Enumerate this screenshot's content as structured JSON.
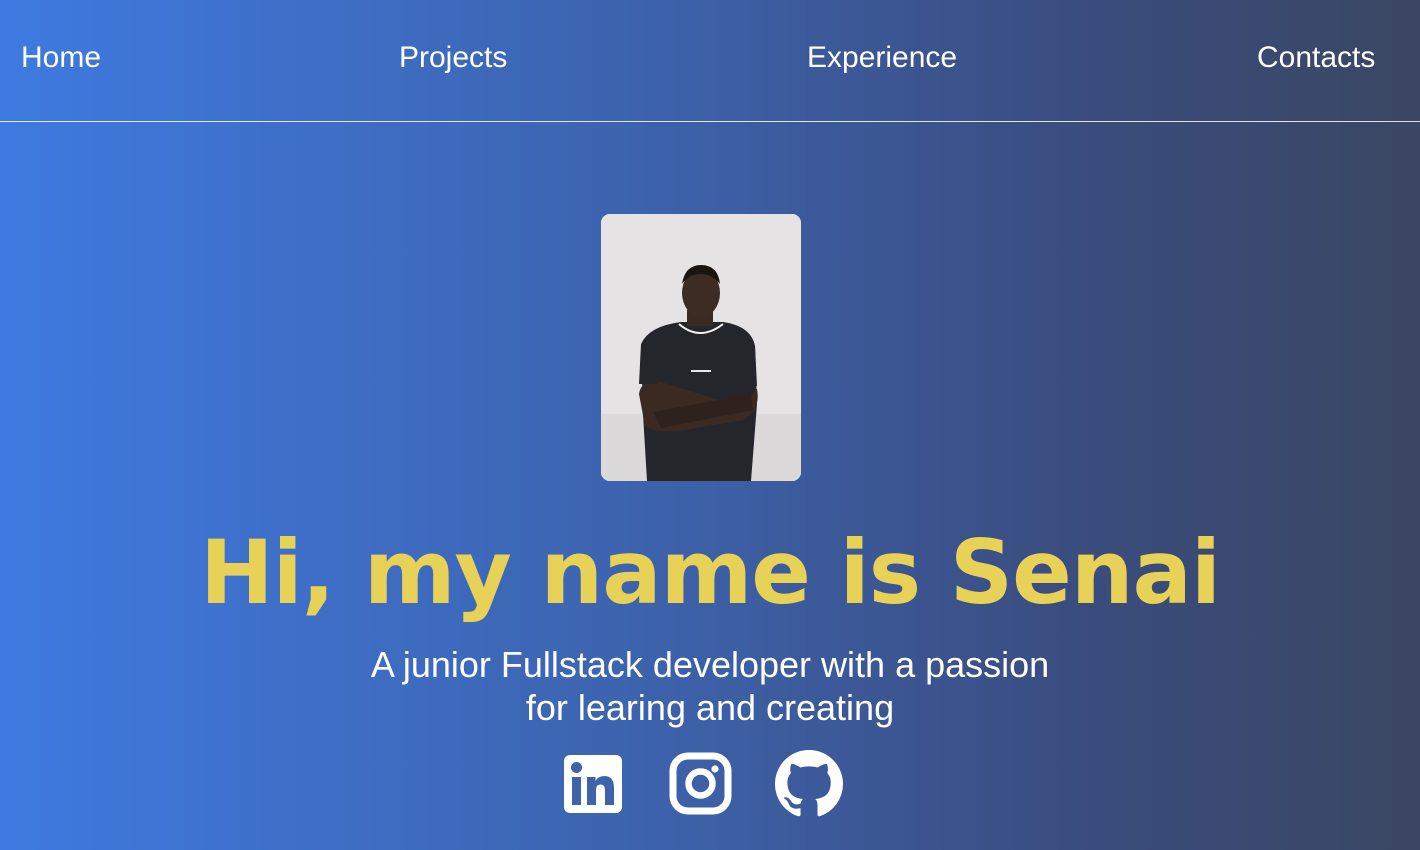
{
  "nav": {
    "home": "Home",
    "projects": "Projects",
    "experience": "Experience",
    "contacts": "Contacts"
  },
  "hero": {
    "headline": "Hi, my name is Senai",
    "tagline_line1": "A junior Fullstack developer with a passion",
    "tagline_line2": "for learing and creating"
  },
  "socials": [
    {
      "icon": "linkedin-icon"
    },
    {
      "icon": "instagram-icon"
    },
    {
      "icon": "github-icon"
    }
  ],
  "colors": {
    "headline": "#e8d157",
    "text": "#ffffff",
    "gradient_start": "#3e7ae0",
    "gradient_end": "#3a4662"
  }
}
